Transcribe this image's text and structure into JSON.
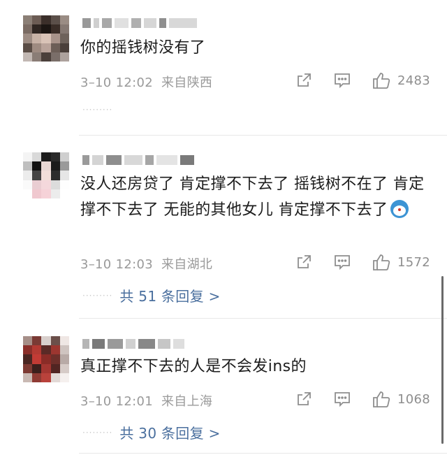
{
  "comments": [
    {
      "text": "你的摇钱树没有了",
      "time": "3–10 12:02",
      "location": "来自陕西",
      "likes": "2483",
      "reply_link": "",
      "avatar_color": "#6b5a4e"
    },
    {
      "text": "没人还房贷了  肯定撑不下去了  摇钱树不在了  肯定撑不下去了  无能的其他女儿  肯定撑不下去了",
      "time": "3–10 12:03",
      "location": "来自湖北",
      "likes": "1572",
      "reply_link": "共 51 条回复 >",
      "avatar_color": "#3b3b3b"
    },
    {
      "text": "真正撑不下去的人是不会发ins的",
      "time": "3–10 12:01",
      "location": "来自上海",
      "likes": "1068",
      "reply_link": "共 30 条回复 >",
      "avatar_color": "#8a3a36"
    }
  ],
  "icons": {
    "share": "share-icon",
    "comment": "comment-icon",
    "like": "thumbs-up-icon"
  },
  "colors": {
    "reply_link": "#4a6f9e",
    "meta": "#9a9a9a"
  }
}
